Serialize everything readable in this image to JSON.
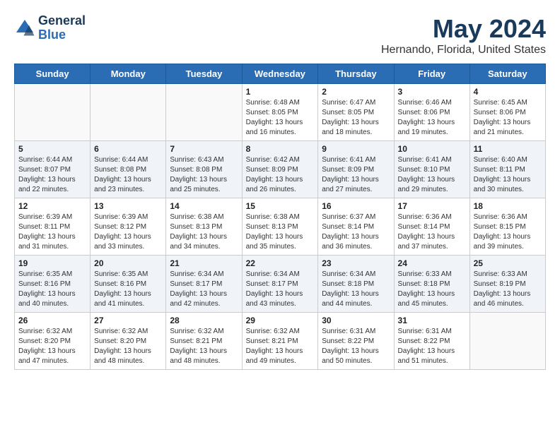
{
  "header": {
    "logo_line1": "General",
    "logo_line2": "Blue",
    "title": "May 2024",
    "subtitle": "Hernando, Florida, United States"
  },
  "days_of_week": [
    "Sunday",
    "Monday",
    "Tuesday",
    "Wednesday",
    "Thursday",
    "Friday",
    "Saturday"
  ],
  "weeks": [
    [
      {
        "day": "",
        "info": ""
      },
      {
        "day": "",
        "info": ""
      },
      {
        "day": "",
        "info": ""
      },
      {
        "day": "1",
        "info": "Sunrise: 6:48 AM\nSunset: 8:05 PM\nDaylight: 13 hours and 16 minutes."
      },
      {
        "day": "2",
        "info": "Sunrise: 6:47 AM\nSunset: 8:05 PM\nDaylight: 13 hours and 18 minutes."
      },
      {
        "day": "3",
        "info": "Sunrise: 6:46 AM\nSunset: 8:06 PM\nDaylight: 13 hours and 19 minutes."
      },
      {
        "day": "4",
        "info": "Sunrise: 6:45 AM\nSunset: 8:06 PM\nDaylight: 13 hours and 21 minutes."
      }
    ],
    [
      {
        "day": "5",
        "info": "Sunrise: 6:44 AM\nSunset: 8:07 PM\nDaylight: 13 hours and 22 minutes."
      },
      {
        "day": "6",
        "info": "Sunrise: 6:44 AM\nSunset: 8:08 PM\nDaylight: 13 hours and 23 minutes."
      },
      {
        "day": "7",
        "info": "Sunrise: 6:43 AM\nSunset: 8:08 PM\nDaylight: 13 hours and 25 minutes."
      },
      {
        "day": "8",
        "info": "Sunrise: 6:42 AM\nSunset: 8:09 PM\nDaylight: 13 hours and 26 minutes."
      },
      {
        "day": "9",
        "info": "Sunrise: 6:41 AM\nSunset: 8:09 PM\nDaylight: 13 hours and 27 minutes."
      },
      {
        "day": "10",
        "info": "Sunrise: 6:41 AM\nSunset: 8:10 PM\nDaylight: 13 hours and 29 minutes."
      },
      {
        "day": "11",
        "info": "Sunrise: 6:40 AM\nSunset: 8:11 PM\nDaylight: 13 hours and 30 minutes."
      }
    ],
    [
      {
        "day": "12",
        "info": "Sunrise: 6:39 AM\nSunset: 8:11 PM\nDaylight: 13 hours and 31 minutes."
      },
      {
        "day": "13",
        "info": "Sunrise: 6:39 AM\nSunset: 8:12 PM\nDaylight: 13 hours and 33 minutes."
      },
      {
        "day": "14",
        "info": "Sunrise: 6:38 AM\nSunset: 8:13 PM\nDaylight: 13 hours and 34 minutes."
      },
      {
        "day": "15",
        "info": "Sunrise: 6:38 AM\nSunset: 8:13 PM\nDaylight: 13 hours and 35 minutes."
      },
      {
        "day": "16",
        "info": "Sunrise: 6:37 AM\nSunset: 8:14 PM\nDaylight: 13 hours and 36 minutes."
      },
      {
        "day": "17",
        "info": "Sunrise: 6:36 AM\nSunset: 8:14 PM\nDaylight: 13 hours and 37 minutes."
      },
      {
        "day": "18",
        "info": "Sunrise: 6:36 AM\nSunset: 8:15 PM\nDaylight: 13 hours and 39 minutes."
      }
    ],
    [
      {
        "day": "19",
        "info": "Sunrise: 6:35 AM\nSunset: 8:16 PM\nDaylight: 13 hours and 40 minutes."
      },
      {
        "day": "20",
        "info": "Sunrise: 6:35 AM\nSunset: 8:16 PM\nDaylight: 13 hours and 41 minutes."
      },
      {
        "day": "21",
        "info": "Sunrise: 6:34 AM\nSunset: 8:17 PM\nDaylight: 13 hours and 42 minutes."
      },
      {
        "day": "22",
        "info": "Sunrise: 6:34 AM\nSunset: 8:17 PM\nDaylight: 13 hours and 43 minutes."
      },
      {
        "day": "23",
        "info": "Sunrise: 6:34 AM\nSunset: 8:18 PM\nDaylight: 13 hours and 44 minutes."
      },
      {
        "day": "24",
        "info": "Sunrise: 6:33 AM\nSunset: 8:18 PM\nDaylight: 13 hours and 45 minutes."
      },
      {
        "day": "25",
        "info": "Sunrise: 6:33 AM\nSunset: 8:19 PM\nDaylight: 13 hours and 46 minutes."
      }
    ],
    [
      {
        "day": "26",
        "info": "Sunrise: 6:32 AM\nSunset: 8:20 PM\nDaylight: 13 hours and 47 minutes."
      },
      {
        "day": "27",
        "info": "Sunrise: 6:32 AM\nSunset: 8:20 PM\nDaylight: 13 hours and 48 minutes."
      },
      {
        "day": "28",
        "info": "Sunrise: 6:32 AM\nSunset: 8:21 PM\nDaylight: 13 hours and 48 minutes."
      },
      {
        "day": "29",
        "info": "Sunrise: 6:32 AM\nSunset: 8:21 PM\nDaylight: 13 hours and 49 minutes."
      },
      {
        "day": "30",
        "info": "Sunrise: 6:31 AM\nSunset: 8:22 PM\nDaylight: 13 hours and 50 minutes."
      },
      {
        "day": "31",
        "info": "Sunrise: 6:31 AM\nSunset: 8:22 PM\nDaylight: 13 hours and 51 minutes."
      },
      {
        "day": "",
        "info": ""
      }
    ]
  ]
}
